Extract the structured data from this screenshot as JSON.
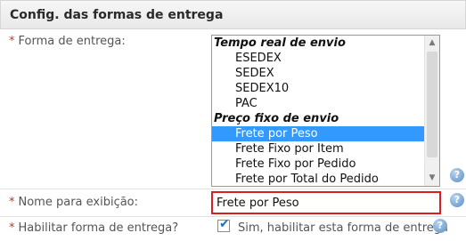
{
  "section": {
    "title": "Config. das formas de entrega"
  },
  "fields": {
    "required_mark": "*",
    "forma_entrega_label": "Forma de entrega:",
    "nome_exibicao_label": "Nome para exibição:",
    "habilitar_label": "Habilitar forma de entrega?"
  },
  "listbox": {
    "groups": [
      {
        "label": "Tempo real de envio",
        "options": [
          "ESEDEX",
          "SEDEX",
          "SEDEX10",
          "PAC"
        ]
      },
      {
        "label": "Preço fixo de envio",
        "options": [
          "Frete por Peso",
          "Frete Fixo por Item",
          "Frete Fixo por Pedido",
          "Frete por Total do Pedido"
        ]
      }
    ],
    "selected": "Frete por Peso"
  },
  "nome_input": {
    "value": "Frete por Peso"
  },
  "habilitar_checkbox": {
    "checked": true,
    "label": "Sim, habilitar esta forma de entrega"
  },
  "icons": {
    "help": "help-icon",
    "help_glyph": "?",
    "scroll_up": "▲",
    "scroll_down": "▼",
    "check": "✔"
  },
  "colors": {
    "selected_bg": "#3399ff",
    "required": "#c0392b",
    "input_border": "#d81e1e"
  }
}
